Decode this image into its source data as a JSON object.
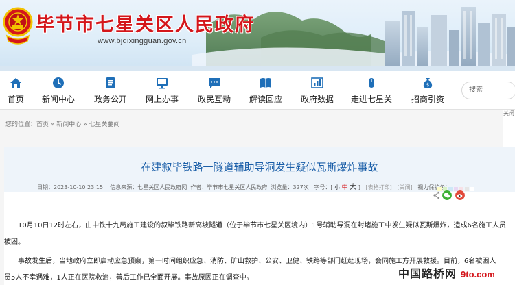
{
  "site": {
    "title": "毕节市七星关区人民政府",
    "url": "www.bjqixingguan.gov.cn"
  },
  "nav": {
    "items": [
      {
        "label": "首页",
        "icon": "home-icon"
      },
      {
        "label": "新闻中心",
        "icon": "clock-icon"
      },
      {
        "label": "政务公开",
        "icon": "document-icon"
      },
      {
        "label": "网上办事",
        "icon": "monitor-icon"
      },
      {
        "label": "政民互动",
        "icon": "chat-icon"
      },
      {
        "label": "解读回应",
        "icon": "book-icon"
      },
      {
        "label": "政府数据",
        "icon": "chart-icon"
      },
      {
        "label": "走进七星关",
        "icon": "mouse-icon"
      },
      {
        "label": "招商引资",
        "icon": "money-bag-icon"
      }
    ],
    "search_placeholder": "搜索"
  },
  "breadcrumb": {
    "prefix": "您的位置：",
    "items": [
      "首页",
      "新闻中心",
      "七星关要闻"
    ],
    "sep": " » "
  },
  "article": {
    "title": "在建叙毕铁路一隧道辅助导洞发生疑似瓦斯爆炸事故",
    "meta": {
      "date": "日期：2023-10-10 23:15",
      "source": "信息来源：七星关区人民政府网",
      "author": "作者：毕节市七星关区人民政府",
      "views": "浏览量：327次",
      "font_label": "字号：[",
      "font_small": "小",
      "font_mid": "中",
      "font_big": "大",
      "font_end": "]",
      "print": "[表格打印]",
      "close": "[关闭]",
      "eye_care": "视力保护色："
    },
    "paragraphs": [
      "10月10日12时左右，由中铁十九局施工建设的叙毕铁路新高坡隧道（位于毕节市七星关区境内）1号辅助导洞在封堵施工中发生疑似瓦斯爆炸，造成6名施工人员",
      "被困。",
      "事故发生后，当地政府立即启动应急预案，第一时间组织应急、消防、矿山救护、公安、卫健、铁路等部门赶赴现场，会同施工方开展救援。目前，6名被困人",
      "员5人不幸遇难，1人正在医院救治，善后工作已全面开展。事故原因正在调查中。"
    ],
    "swatch_colors": [
      "#fdfcc8",
      "#d9f3c7",
      "#cfe8f7",
      "#e9d8f3",
      "#f7e0e6",
      "#e6e6e6",
      "#ffffff"
    ],
    "share": [
      {
        "icon": "share-icon",
        "color": "#888888"
      },
      {
        "icon": "wechat-icon",
        "color": "#3cb034"
      },
      {
        "icon": "weibo-icon",
        "color": "#e24a3b"
      }
    ]
  },
  "side_tag": "关闭",
  "watermark": {
    "cn": "中国路桥网",
    "en": "9to.com"
  },
  "colors": {
    "title_red": "#d4161b",
    "nav_blue": "#1f6fb8",
    "link_blue": "#1a5ea8"
  }
}
